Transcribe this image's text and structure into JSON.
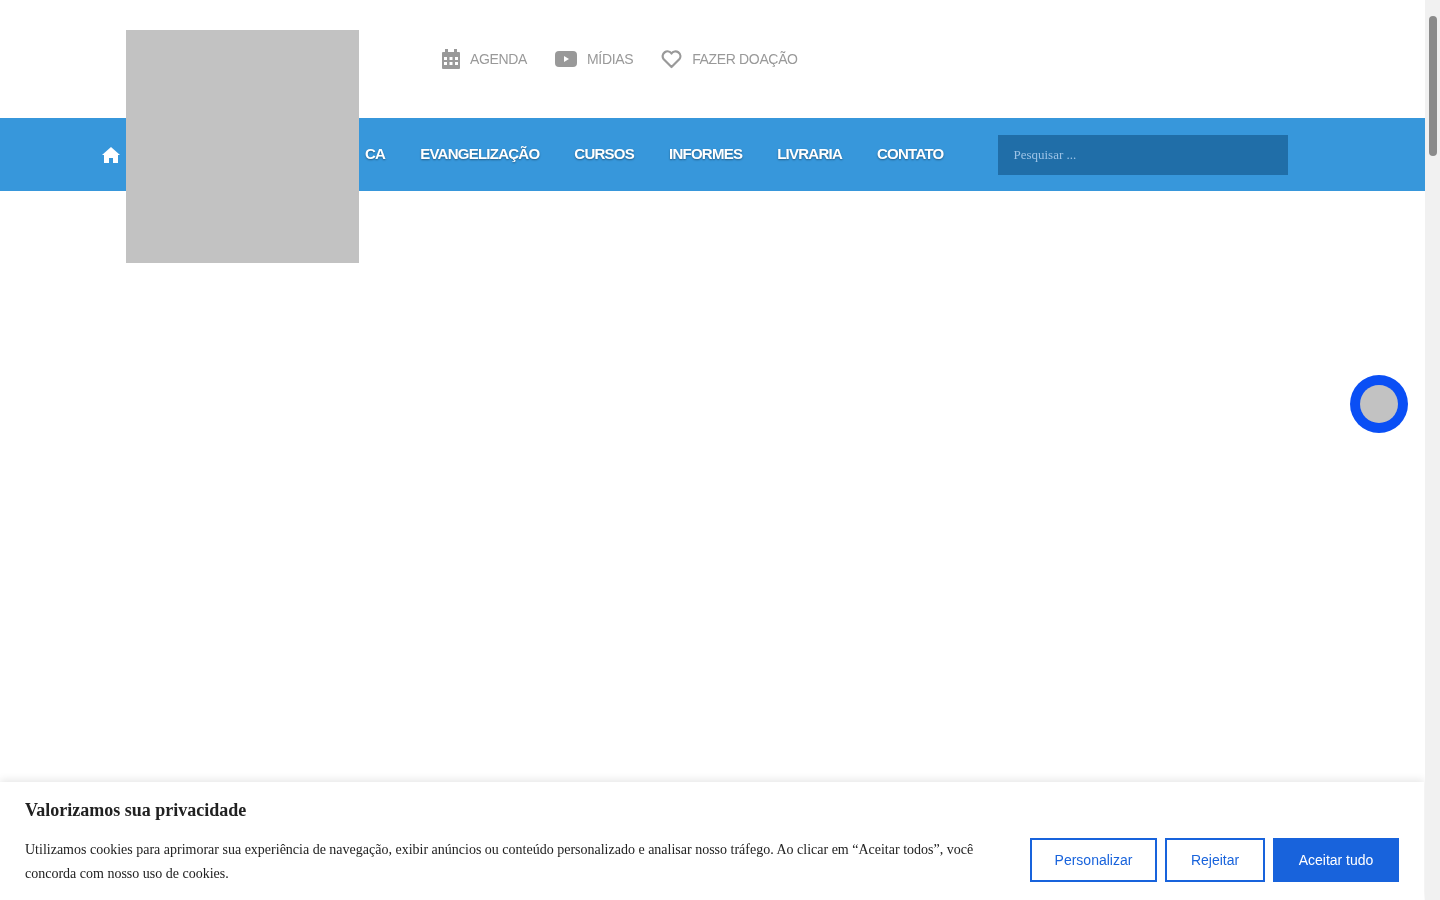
{
  "top_links": [
    {
      "kind": "calendar",
      "label": "AGENDA"
    },
    {
      "kind": "video",
      "label": "MÍDIAS"
    },
    {
      "kind": "heart",
      "label": "FAZER DOAÇÃO"
    }
  ],
  "nav": {
    "items": [
      {
        "label": "CA"
      },
      {
        "label": "EVANGELIZAÇÃO"
      },
      {
        "label": "CURSOS"
      },
      {
        "label": "INFORMES"
      },
      {
        "label": "LIVRARIA"
      },
      {
        "label": "CONTATO"
      }
    ],
    "search": {
      "placeholder": "Pesquisar ..."
    }
  },
  "cookie_banner": {
    "title": "Valorizamos sua privacidade",
    "text": "Utilizamos cookies para aprimorar sua experiência de navegação, exibir anúncios ou conteúdo personalizado e analisar nosso tráfego. Ao clicar em “Aceitar todos”, você concorda com nosso uso de cookies.",
    "buttons": [
      {
        "label": "Personalizar",
        "primary": false
      },
      {
        "label": "Rejeitar",
        "primary": false
      },
      {
        "label": "Aceitar tudo",
        "primary": true
      }
    ]
  }
}
